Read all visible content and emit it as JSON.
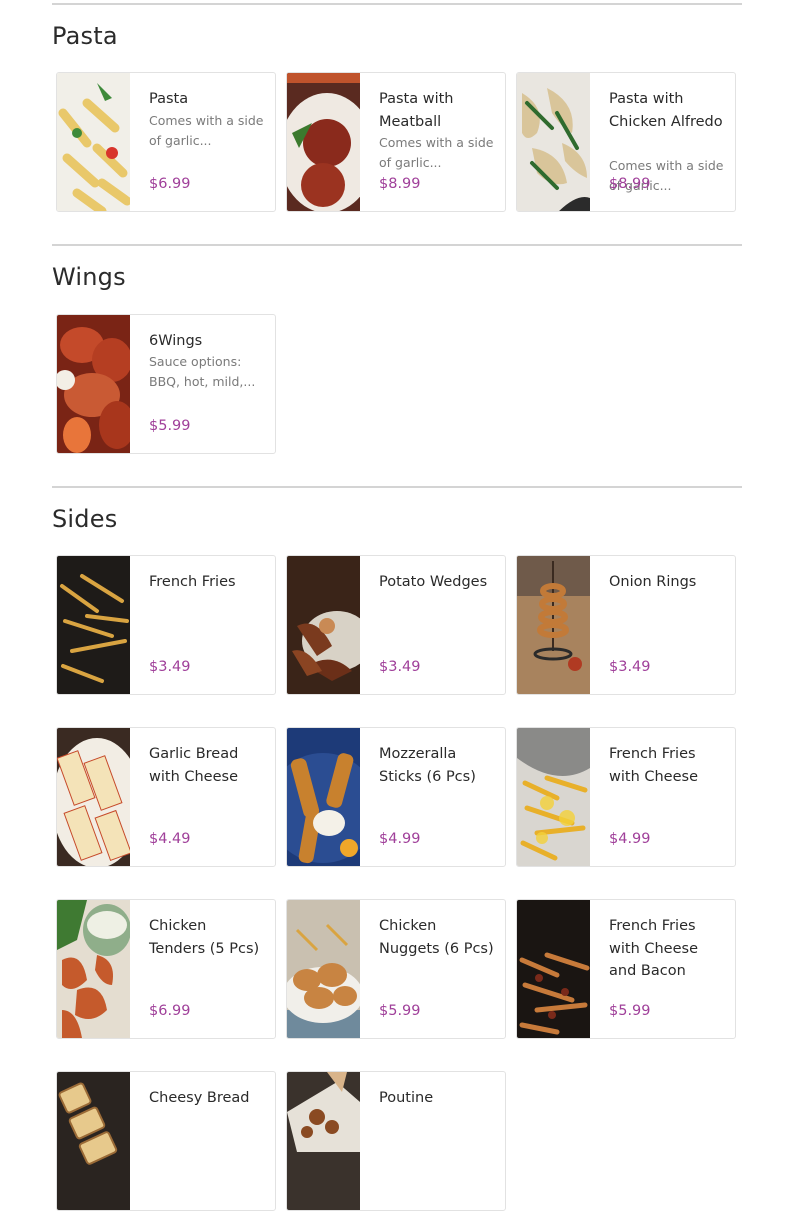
{
  "sections": {
    "pasta": {
      "title": "Pasta",
      "items": [
        {
          "name": "Pasta",
          "description": "Comes with a side of garlic...",
          "price": "$6.99"
        },
        {
          "name": "Pasta with Meatball",
          "description": "Comes with a side of garlic...",
          "price": "$8.99"
        },
        {
          "name": "Pasta with Chicken Alfredo",
          "description": "Comes with a side of garlic...",
          "price": "$8.99"
        }
      ]
    },
    "wings": {
      "title": "Wings",
      "items": [
        {
          "name": "6Wings",
          "description": "Sauce options: BBQ, hot, mild,...",
          "price": "$5.99"
        }
      ]
    },
    "sides": {
      "title": "Sides",
      "items": [
        {
          "name": "French Fries",
          "price": "$3.49"
        },
        {
          "name": "Potato Wedges",
          "price": "$3.49"
        },
        {
          "name": "Onion Rings",
          "price": "$3.49"
        },
        {
          "name": "Garlic Bread with Cheese",
          "price": "$4.49"
        },
        {
          "name": "Mozzeralla Sticks (6 Pcs)",
          "price": "$4.99"
        },
        {
          "name": "French Fries with Cheese",
          "price": "$4.99"
        },
        {
          "name": "Chicken Tenders (5 Pcs)",
          "price": "$6.99"
        },
        {
          "name": "Chicken Nuggets (6 Pcs)",
          "price": "$5.99"
        },
        {
          "name": "French Fries with Cheese and Bacon",
          "price": "$5.99"
        },
        {
          "name": "Cheesy Bread"
        },
        {
          "name": "Poutine"
        }
      ]
    }
  },
  "colors": {
    "price": "#a0409a",
    "divider": "#d4d4d4",
    "card_border": "#e2e2e2"
  }
}
